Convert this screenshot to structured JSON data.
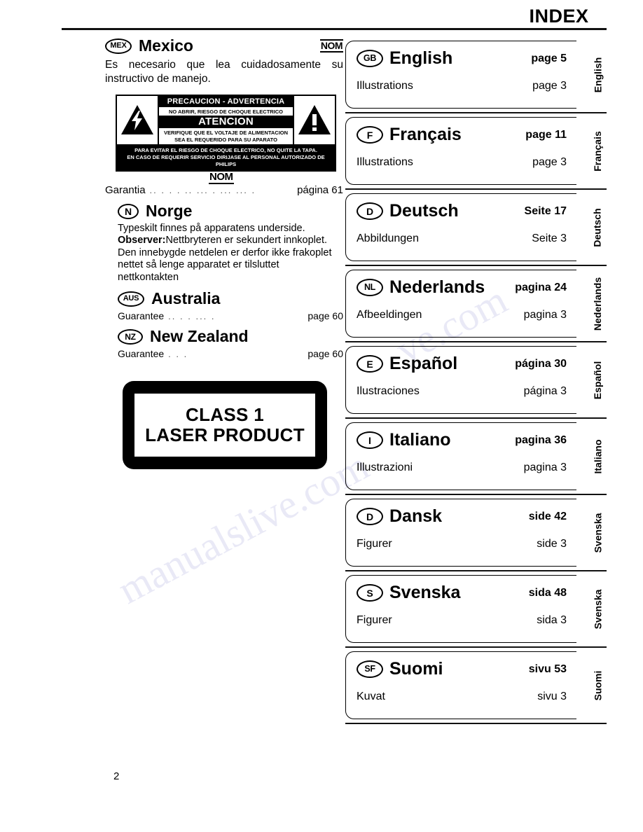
{
  "header": {
    "title": "INDEX"
  },
  "page_number": "2",
  "left_column": {
    "mexico": {
      "badge": "MEX",
      "name": "Mexico",
      "nom_mark": "NOM",
      "body": "Es necesario que lea cuidadosamente su instructivo de manejo.",
      "caution_label": {
        "title": "PRECAUCION - ADVERTENCIA",
        "subtitle": "NO ABRIR, RIESGO DE CHOQUE ELECTRICO",
        "atencion": "ATENCION",
        "voltage_line1": "VERIFIQUE QUE EL VOLTAJE DE ALIMENTACION",
        "voltage_line2": "SEA EL REQUERIDO PARA SU APARATO",
        "footer_line1": "PARA EVITAR EL RIESGO DE CHOQUE ELECTRICO, NO QUITE LA TAPA.",
        "footer_line2": "EN CASO DE REQUERIR SERVICIO  DIRIJASE AL PERSONAL AUTORIZADO DE PHILIPS"
      },
      "nom_mark_under": "NOM",
      "guarantee_label": "Garantia",
      "guarantee_dots": ".. . . . .. ... . ... ... .",
      "guarantee_page": "página 61"
    },
    "norge": {
      "badge": "N",
      "name": "Norge",
      "line1": "Typeskilt finnes på apparatens underside.",
      "observer_label": "Observer:",
      "observer_text": "Nettbryteren er sekundert innkoplet.",
      "line3": "Den innebygde netdelen er derfor ikke frakoplet",
      "line4": "nettet så lenge apparatet er tilsluttet",
      "line5": "nettkontakten"
    },
    "australia": {
      "badge": "AUS",
      "name": "Australia",
      "guarantee_label": "Guarantee",
      "guarantee_dots": ".. . . ... .",
      "guarantee_page": "page 60"
    },
    "new_zealand": {
      "badge": "NZ",
      "name": "New Zealand",
      "guarantee_label": "Guarantee",
      "guarantee_dots": ". . .",
      "guarantee_page": "page 60"
    },
    "laser_label": {
      "line1": "CLASS 1",
      "line2": "LASER PRODUCT"
    }
  },
  "index_cards": [
    {
      "badge": "GB",
      "language": "English",
      "page_label": "page 5",
      "illustrations_label": "Illustrations",
      "illustrations_page": "page 3",
      "tab": "English"
    },
    {
      "badge": "F",
      "language": "Français",
      "page_label": "page 11",
      "illustrations_label": "Illustrations",
      "illustrations_page": "page 3",
      "tab": "Français"
    },
    {
      "badge": "D",
      "language": "Deutsch",
      "page_label": "Seite 17",
      "illustrations_label": "Abbildungen",
      "illustrations_page": "Seite 3",
      "tab": "Deutsch"
    },
    {
      "badge": "NL",
      "language": "Nederlands",
      "page_label": "pagina 24",
      "illustrations_label": "Afbeeldingen",
      "illustrations_page": "pagina 3",
      "tab": "Nederlands"
    },
    {
      "badge": "E",
      "language": "Español",
      "page_label": "página 30",
      "illustrations_label": "Ilustraciones",
      "illustrations_page": "página 3",
      "tab": "Español"
    },
    {
      "badge": "I",
      "language": "Italiano",
      "page_label": "pagina 36",
      "illustrations_label": "Illustrazioni",
      "illustrations_page": "pagina 3",
      "tab": "Italiano"
    },
    {
      "badge": "D",
      "language": "Dansk",
      "page_label": "side 42",
      "illustrations_label": "Figurer",
      "illustrations_page": "side 3",
      "tab": "Svenska"
    },
    {
      "badge": "S",
      "language": "Svenska",
      "page_label": "sida 48",
      "illustrations_label": "Figurer",
      "illustrations_page": "sida 3",
      "tab": "Svenska"
    },
    {
      "badge": "SF",
      "language": "Suomi",
      "page_label": "sivu 53",
      "illustrations_label": "Kuvat",
      "illustrations_page": "sivu 3",
      "tab": "Suomi"
    }
  ]
}
